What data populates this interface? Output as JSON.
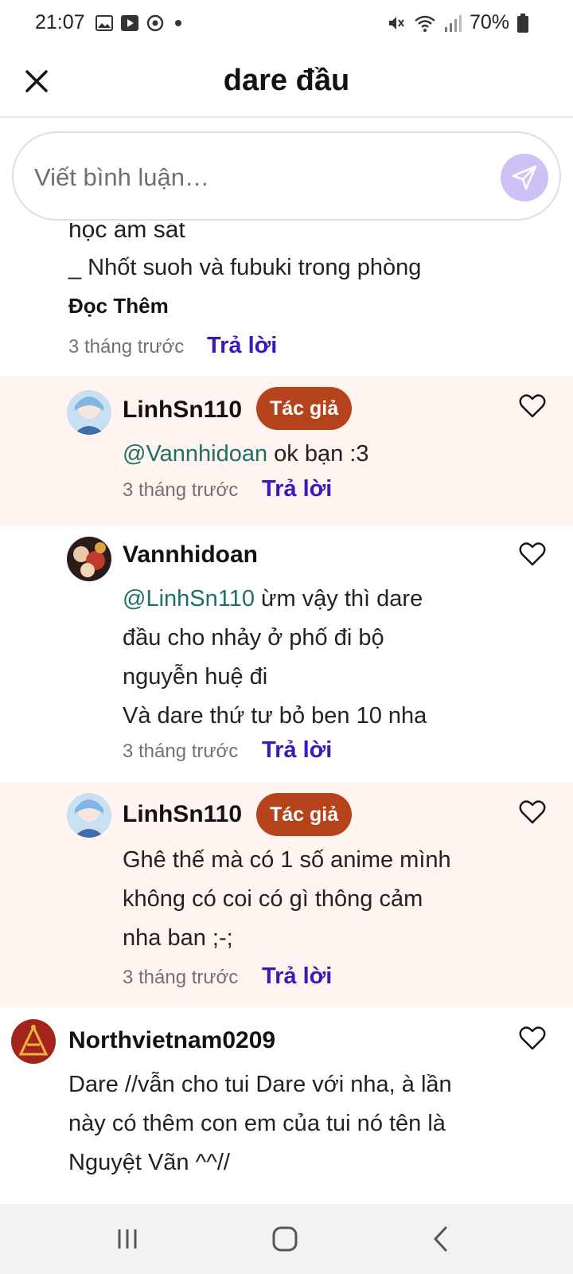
{
  "status_bar": {
    "time": "21:07",
    "battery": "70%",
    "left_icons": [
      "gallery-icon",
      "youtube-icon",
      "messenger-icon",
      "dot-icon"
    ],
    "right_icons": [
      "mute-icon",
      "wifi-icon",
      "signal-icon",
      "battery-icon"
    ]
  },
  "header": {
    "title": "dare đầu",
    "close_icon": "close-icon"
  },
  "comment_input": {
    "placeholder": "Viết bình luận…",
    "send_icon": "send-icon"
  },
  "feed": {
    "clipped_line": "học ám sát",
    "top_comment": {
      "last_line": "_ Nhốt suoh và fubuki trong phòng",
      "read_more": "Đọc Thêm",
      "time": "3 tháng trước",
      "reply": "Trả lời"
    },
    "replies": [
      {
        "username": "LinhSn110",
        "badge": "Tác giả",
        "mention": "@Vannhidoan",
        "text": " ok bạn :3",
        "time": "3 tháng trước",
        "reply": "Trả lời"
      },
      {
        "username": "Vannhidoan",
        "mention": "@LinhSn110",
        "text": " ừm vậy thì dare\nđầu cho nhảy ở phố đi bộ\nnguyễn huệ đi\nVà dare thứ tư  bỏ ben 10 nha",
        "time": "3 tháng trước",
        "reply": "Trả lời"
      },
      {
        "username": "LinhSn110",
        "badge": "Tác giả",
        "text": "Ghê thế mà có 1 số anime mình\nkhông có coi có gì thông cảm\nnha ban ;-;",
        "time": "3 tháng trước",
        "reply": "Trả lời"
      }
    ],
    "next_comment": {
      "username": "Northvietnam0209",
      "text": "Dare //vẫn cho tui Dare với nha, à lần\nnày có thêm con em của tui nó tên là\nNguyệt Vãn ^^//"
    }
  },
  "colors": {
    "author_bg": "#fff4ef",
    "badge": "#b5431b",
    "reply_link": "#3b19b8",
    "mention": "#1d6f67",
    "send_button": "#cfc0f6"
  },
  "nav_bar": {
    "icons": [
      "recent-apps-icon",
      "home-icon",
      "back-icon"
    ]
  }
}
